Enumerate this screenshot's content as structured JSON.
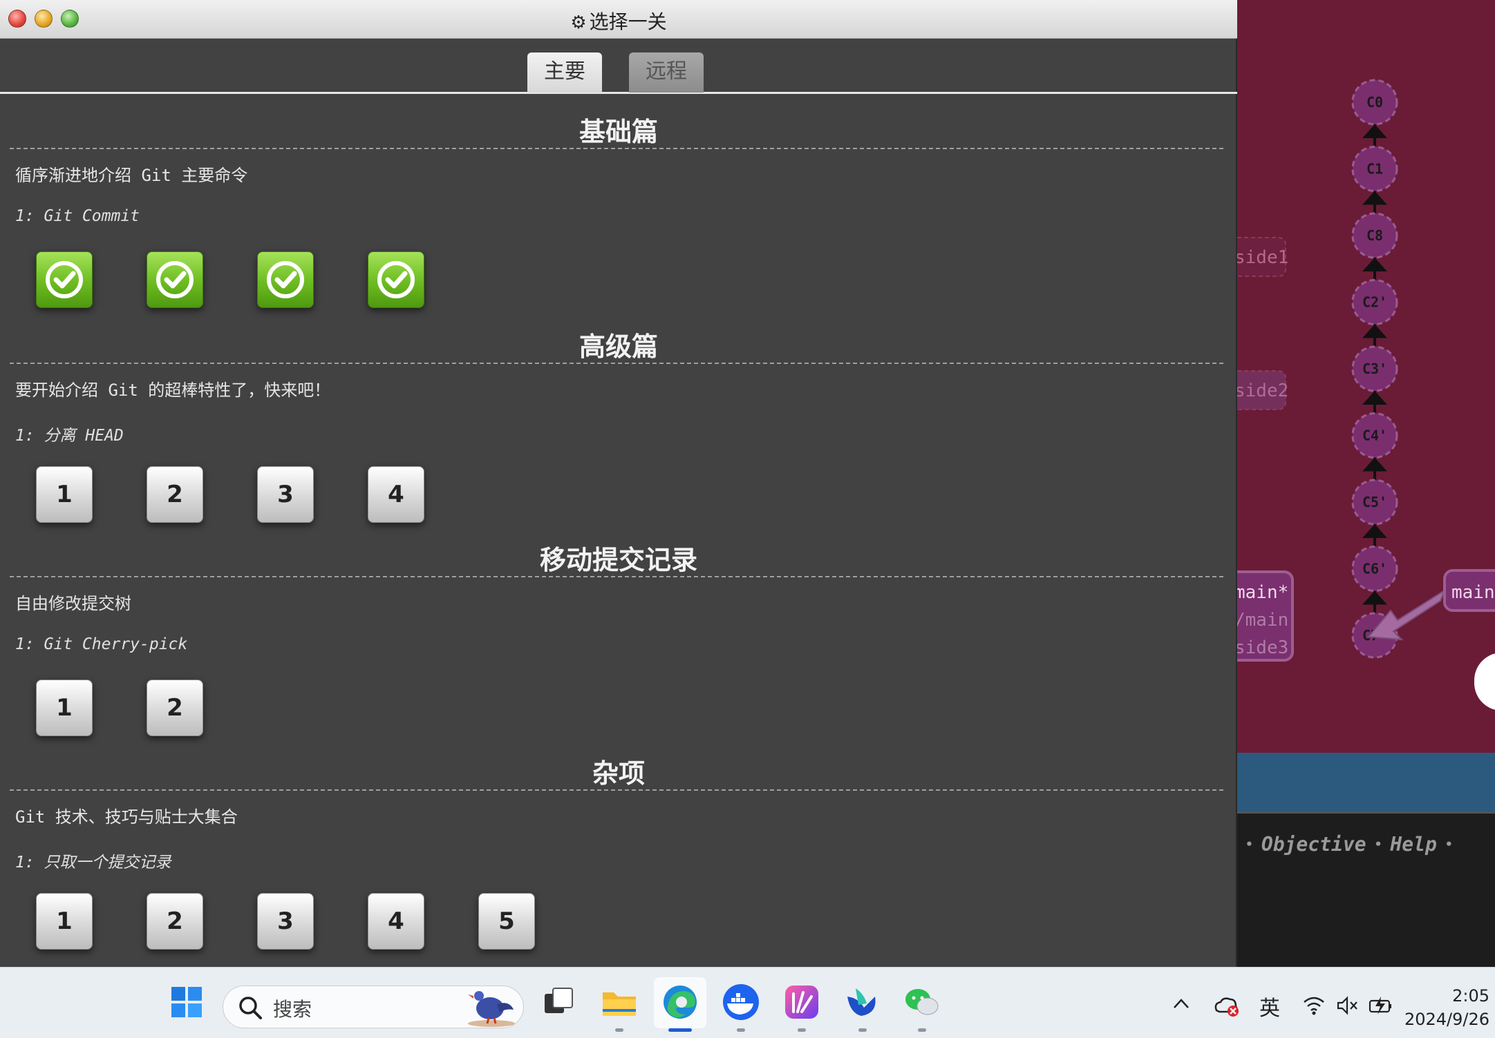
{
  "window": {
    "title": "选择一关",
    "tabs": [
      {
        "label": "主要",
        "active": true
      },
      {
        "label": "远程",
        "active": false
      }
    ]
  },
  "sections": [
    {
      "title": "基础篇",
      "description": "循序渐进地介绍 Git 主要命令",
      "subtitle": "1: Git Commit",
      "levels": [
        {
          "label": "",
          "completed": true
        },
        {
          "label": "",
          "completed": true
        },
        {
          "label": "",
          "completed": true
        },
        {
          "label": "",
          "completed": true
        }
      ]
    },
    {
      "title": "高级篇",
      "description": "要开始介绍 Git 的超棒特性了，快来吧！",
      "subtitle": "1: 分离 HEAD",
      "levels": [
        {
          "label": "1",
          "completed": false
        },
        {
          "label": "2",
          "completed": false
        },
        {
          "label": "3",
          "completed": false
        },
        {
          "label": "4",
          "completed": false
        }
      ]
    },
    {
      "title": "移动提交记录",
      "description": "自由修改提交树",
      "subtitle": "1: Git Cherry-pick",
      "levels": [
        {
          "label": "1",
          "completed": false
        },
        {
          "label": "2",
          "completed": false
        }
      ]
    },
    {
      "title": "杂项",
      "description": "Git 技术、技巧与贴士大集合",
      "subtitle": "1: 只取一个提交记录",
      "levels": [
        {
          "label": "1",
          "completed": false
        },
        {
          "label": "2",
          "completed": false
        },
        {
          "label": "3",
          "completed": false
        },
        {
          "label": "4",
          "completed": false
        },
        {
          "label": "5",
          "completed": false
        }
      ]
    }
  ],
  "visualization": {
    "commits": [
      "C0",
      "C1",
      "C8",
      "C2'",
      "C3'",
      "C4'",
      "C5'",
      "C6'",
      "C7'"
    ],
    "branch_labels": [
      "side1",
      "side2",
      "main*",
      "/main",
      "side3",
      "main"
    ],
    "command_links": [
      "Objective",
      "Help"
    ]
  },
  "taskbar": {
    "search_placeholder": "搜索",
    "ime_label": "英",
    "time": "2:05",
    "date": "2024/9/26"
  },
  "colors": {
    "viz_background": "#6a1c36",
    "window_background": "#424242",
    "completed_level": "#6cbc20",
    "commit_node": "#7a2e6e"
  }
}
